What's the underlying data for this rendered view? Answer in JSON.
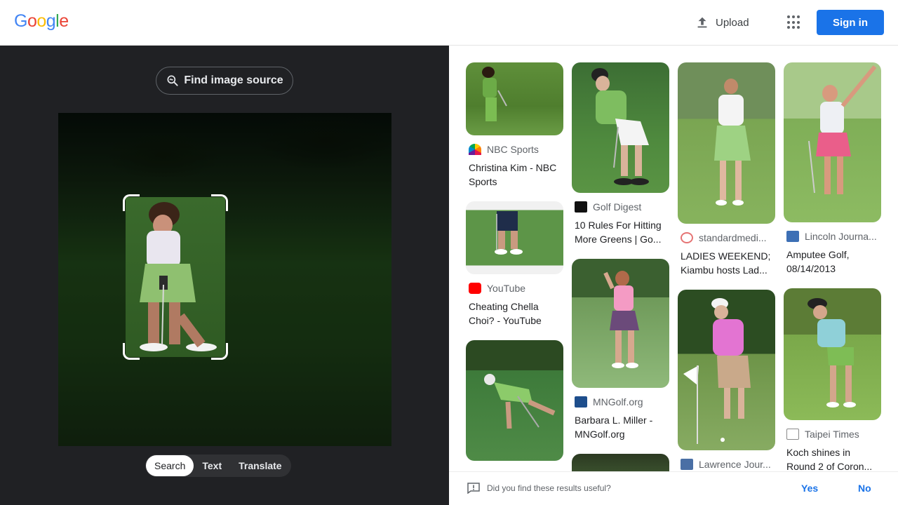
{
  "header": {
    "logo_letters": [
      {
        "ch": "G",
        "color": "#4285F4"
      },
      {
        "ch": "o",
        "color": "#EA4335"
      },
      {
        "ch": "o",
        "color": "#FBBC05"
      },
      {
        "ch": "g",
        "color": "#4285F4"
      },
      {
        "ch": "l",
        "color": "#34A853"
      },
      {
        "ch": "e",
        "color": "#EA4335"
      }
    ],
    "upload_label": "Upload",
    "apps_icon": "apps-grid-icon",
    "signin_label": "Sign in"
  },
  "left": {
    "find_source_label": "Find image source",
    "modes": [
      "Search",
      "Text",
      "Translate"
    ],
    "active_mode": "Search"
  },
  "results": [
    {
      "source": "NBC Sports",
      "title": "Christina Kim - NBC Sports",
      "fav_color": "#ff6d00"
    },
    {
      "source": "YouTube",
      "title": "Cheating Chella Choi? - YouTube",
      "fav_color": "#ff0000"
    },
    {
      "source": "",
      "title": "",
      "fav_color": ""
    },
    {
      "source": "Golf Digest",
      "title": "10 Rules For Hitting More Greens | Go...",
      "fav_color": "#111111"
    },
    {
      "source": "MNGolf.org",
      "title": "Barbara L. Miller - MNGolf.org",
      "fav_color": "#1e4e8c"
    },
    {
      "source": "",
      "title": "",
      "fav_color": ""
    },
    {
      "source": "standardmedi...",
      "title": "LADIES WEEKEND; Kiambu hosts Lad...",
      "fav_color": "#e57373"
    },
    {
      "source": "Lawrence Jour...",
      "title": "",
      "fav_color": "#4a6fa5"
    },
    {
      "source": "Lincoln Journa...",
      "title": "Amputee Golf, 08/14/2013",
      "fav_color": "#3d6fb5"
    },
    {
      "source": "Taipei Times",
      "title": "Koch shines in Round 2 of Coron...",
      "fav_color": "#8a8a8a"
    }
  ],
  "feedback": {
    "question": "Did you find these results useful?",
    "yes": "Yes",
    "no": "No"
  }
}
